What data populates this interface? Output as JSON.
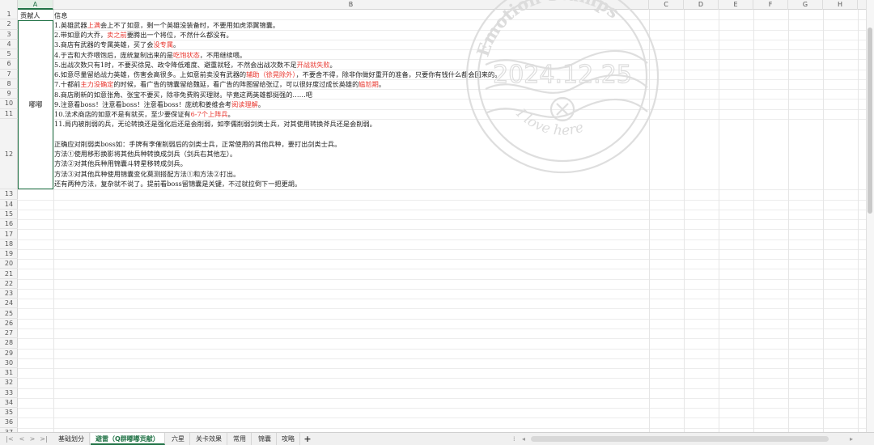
{
  "columns": [
    "A",
    "B",
    "C",
    "D",
    "E",
    "F",
    "G",
    "H"
  ],
  "active_column": "A",
  "rows": [
    "1",
    "2",
    "3",
    "4",
    "5",
    "6",
    "7",
    "8",
    "9",
    "10",
    "11",
    "12",
    "13",
    "14",
    "15",
    "16",
    "17",
    "18",
    "19",
    "20",
    "21",
    "22",
    "23",
    "24",
    "25",
    "26",
    "27",
    "28",
    "29",
    "30",
    "31",
    "32",
    "33",
    "34",
    "35",
    "36",
    "37"
  ],
  "header": {
    "a1": "贡献人",
    "b1": "信息"
  },
  "contributor": "嘟嘟",
  "lines": [
    {
      "segments": [
        {
          "t": "1.英雄武器"
        },
        {
          "t": "上满",
          "red": true
        },
        {
          "t": "会上不了如意，剩一个英雄没装备时，不要用如虎添翼锦囊。"
        }
      ]
    },
    {
      "segments": [
        {
          "t": "2.带如意的大乔，"
        },
        {
          "t": "卖之前",
          "red": true
        },
        {
          "t": "要腾出一个将位，不然什么都没有。"
        }
      ]
    },
    {
      "segments": [
        {
          "t": "3.商店有武器的专属英雄，买了会"
        },
        {
          "t": "没专属",
          "red": true
        },
        {
          "t": "。"
        }
      ]
    },
    {
      "segments": [
        {
          "t": "4.于吉和大乔喂饱后，庞统复制出来的是"
        },
        {
          "t": "吃饱状态",
          "red": true
        },
        {
          "t": "，不用继续喂。"
        }
      ]
    },
    {
      "segments": [
        {
          "t": "5.出战次数只有1时，不要买徐晃、政令降低难度、避重就轻，不然会出战次数不足"
        },
        {
          "t": "开战就失败",
          "red": true
        },
        {
          "t": "。"
        }
      ]
    },
    {
      "segments": [
        {
          "t": "6.如意尽量留给战力英雄，伤害会高很多。上如意前卖没有武器的"
        },
        {
          "t": "辅助（徐晃除外）",
          "red": true
        },
        {
          "t": "，不要舍不得，除非你做好重开的准备，只要你有钱什么都会回来的。"
        }
      ]
    },
    {
      "segments": [
        {
          "t": "7.十都前"
        },
        {
          "t": "主力没确定",
          "red": true
        },
        {
          "t": "的时候，看广告的锦囊留给魏延，看广告的阵图留给张辽，可以很好度过成长英雄的"
        },
        {
          "t": "尴尬期",
          "red": true
        },
        {
          "t": "。"
        }
      ]
    },
    {
      "segments": [
        {
          "t": "8.商店刷新的如意张角、张宝不要买，除非免费购买理财。毕竟这两英雄都挺强的……吧"
        }
      ]
    },
    {
      "segments": [
        {
          "t": "9.注意看boss！注意看boss！注意看boss！庞统和姜维会考"
        },
        {
          "t": "阅读理解",
          "red": true
        },
        {
          "t": "。"
        }
      ]
    },
    {
      "segments": [
        {
          "t": "10.法术商店的如意不是有就买，至少要保证有"
        },
        {
          "t": "6-7个上阵兵",
          "red": true
        },
        {
          "t": "。"
        }
      ]
    },
    {
      "segments": [
        {
          "t": "11.局内被削弱的兵，无论转换还是强化后还是会削弱，如李儒削弱剑类士兵，对其使用转换斧兵还是会削弱。"
        }
      ]
    },
    {
      "segments": [
        {
          "t": ""
        }
      ]
    },
    {
      "segments": [
        {
          "t": "正确应对削弱类boss如：手牌有李傕削弱后的剑类士兵，正常使用的其他兵种，要打出剑类士兵。"
        }
      ]
    },
    {
      "segments": [
        {
          "t": "方法①使用移形换影将其他兵种转换成剑兵（剑兵右其他左）。"
        }
      ]
    },
    {
      "segments": [
        {
          "t": "方法②对其他兵种用锦囊斗转星移转成剑兵。"
        }
      ]
    },
    {
      "segments": [
        {
          "t": "方法③对其他兵种使用锦囊变化莫测搭配方法①和方法②打出。"
        }
      ]
    },
    {
      "segments": [
        {
          "t": "还有两种方法，复杂就不说了。提前看boss留锦囊是关键，不过就拉倒下一把更胡。"
        }
      ]
    }
  ],
  "watermark": {
    "top_text": "Emotion Stamps",
    "date": "2024.12.25",
    "bottom_text": "I love here"
  },
  "tabs": [
    {
      "label": "基础划分",
      "active": false
    },
    {
      "label": "避雷（Q群嘟嘟贡献）",
      "active": true
    },
    {
      "label": "六星",
      "active": false
    },
    {
      "label": "关卡效果",
      "active": false
    },
    {
      "label": "常用",
      "active": false
    },
    {
      "label": "锦囊",
      "active": false
    },
    {
      "label": "攻略",
      "active": false
    }
  ],
  "add_tab_label": "+",
  "colors": {
    "accent": "#217346",
    "highlight_text": "#e8372f"
  }
}
